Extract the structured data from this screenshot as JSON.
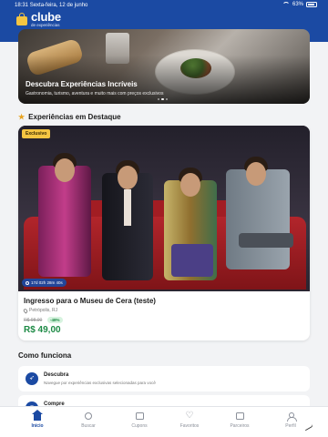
{
  "status": {
    "time": "18:31",
    "date": "Sexta-feira, 12 de junho",
    "battery": "63%"
  },
  "brand": {
    "name": "clube",
    "tagline": "de experiências",
    "primary_color": "#1b4aa3",
    "accent_color": "#f4c542"
  },
  "hero": {
    "title": "Descubra Experiências Incríveis",
    "subtitle": "Gastronomia, turismo, aventura e muito mais com preços exclusivos",
    "slides": 3,
    "active_slide": 1
  },
  "featured": {
    "section_title": "Experiências em Destaque",
    "card": {
      "badge": "Exclusivo",
      "timer": "17d 02h 28m 40s",
      "name": "Ingresso para o Museu de Cera (teste)",
      "location": "Petrópolis, RJ",
      "old_price": "R$ 98,00",
      "discount": "-48%",
      "price": "R$ 49,00"
    }
  },
  "how": {
    "title": "Como funciona",
    "steps": [
      {
        "title": "Descubra",
        "desc": "Navegue por experiências exclusivas selecionadas para você",
        "icon": "compass-icon"
      },
      {
        "title": "Compre",
        "desc": "",
        "icon": "cart-icon"
      }
    ]
  },
  "tabs": [
    {
      "label": "Início",
      "icon": "home-icon",
      "active": true
    },
    {
      "label": "Buscar",
      "icon": "search-icon",
      "active": false
    },
    {
      "label": "Cupons",
      "icon": "ticket-icon",
      "active": false
    },
    {
      "label": "Favoritos",
      "icon": "heart-icon",
      "active": false
    },
    {
      "label": "Parceiros",
      "icon": "store-icon",
      "active": false
    },
    {
      "label": "Perfil",
      "icon": "user-icon",
      "active": false
    }
  ]
}
